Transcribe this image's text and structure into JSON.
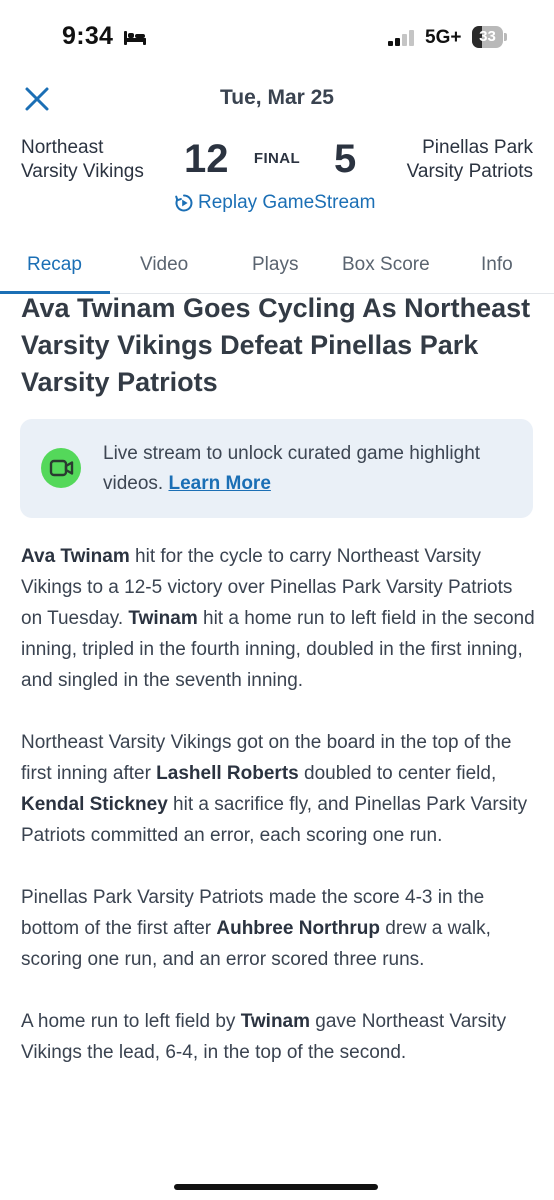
{
  "status_bar": {
    "time": "9:34",
    "network": "5G+",
    "battery_level": "33",
    "battery_fraction": 0.33
  },
  "header": {
    "date": "Tue, Mar 25",
    "close_icon": "close-icon",
    "home_team_line1": "Northeast",
    "home_team_line2": "Varsity Vikings",
    "home_score": "12",
    "status": "FINAL",
    "away_score": "5",
    "away_team_line1": "Pinellas Park",
    "away_team_line2": "Varsity Patriots",
    "replay_label": "Replay GameStream"
  },
  "tabs": [
    {
      "label": "Recap",
      "active": true
    },
    {
      "label": "Video",
      "active": false
    },
    {
      "label": "Plays",
      "active": false
    },
    {
      "label": "Box Score",
      "active": false
    },
    {
      "label": "Info",
      "active": false
    }
  ],
  "article": {
    "headline": "Ava Twinam Goes Cycling As Northeast Varsity Vikings Defeat Pinellas Park Varsity Patriots",
    "notice_text": "Live stream to unlock curated game highlight videos.",
    "notice_link": "Learn More",
    "paragraphs": [
      [
        {
          "text": "Ava Twinam",
          "bold": true
        },
        {
          "text": " hit for the cycle to carry Northeast Varsity Vikings to a 12-5 victory over Pinellas Park Varsity Patriots on Tuesday. ",
          "bold": false
        },
        {
          "text": "Twinam",
          "bold": true
        },
        {
          "text": " hit a home run to left field in the second inning, tripled in the fourth inning, doubled in the first inning, and singled in the seventh inning.",
          "bold": false
        }
      ],
      [
        {
          "text": "Northeast Varsity Vikings got on the board in the top of the first inning after ",
          "bold": false
        },
        {
          "text": "Lashell Roberts",
          "bold": true
        },
        {
          "text": " doubled to center field, ",
          "bold": false
        },
        {
          "text": "Kendal Stickney",
          "bold": true
        },
        {
          "text": " hit a sacrifice fly, and Pinellas Park Varsity Patriots committed an error, each scoring one run.",
          "bold": false
        }
      ],
      [
        {
          "text": "Pinellas Park Varsity Patriots made the score 4-3 in the bottom of the first after ",
          "bold": false
        },
        {
          "text": "Auhbree Northrup",
          "bold": true
        },
        {
          "text": " drew a walk, scoring one run, and an error scored three runs.",
          "bold": false
        }
      ],
      [
        {
          "text": "A home run to left field by ",
          "bold": false
        },
        {
          "text": "Twinam",
          "bold": true
        },
        {
          "text": " gave Northeast Varsity Vikings the lead, 6-4, in the top of the second.",
          "bold": false
        }
      ]
    ]
  },
  "colors": {
    "accent": "#1b6fb5",
    "notice_background": "#eaf0f7",
    "video_icon_green": "#54d85a"
  }
}
